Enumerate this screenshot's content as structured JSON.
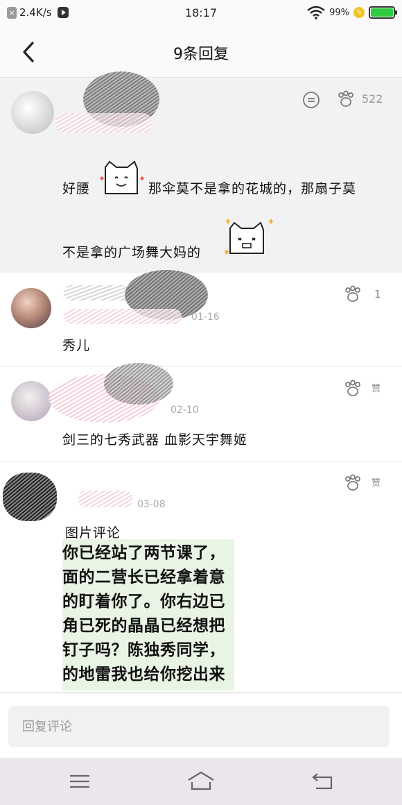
{
  "status_bar": {
    "close_glyph": "×",
    "speed": "2.4K/s",
    "time": "18:17",
    "battery_percent": "99%",
    "battery_level": 0.99,
    "bolt_glyph": "ϟ",
    "icons": [
      "notification-close-icon",
      "video-player-icon",
      "wifi-icon",
      "charging-icon",
      "battery-icon"
    ]
  },
  "header": {
    "title": "9条回复",
    "back_icon": "chevron-left-icon"
  },
  "main_post": {
    "like_count": "522",
    "line1_a": "好腰",
    "line1_b": "那伞莫不是拿的花城的，那扇子莫",
    "line2": "不是拿的广场舞大妈的",
    "icons": [
      "comment-bubble-icon",
      "paw-like-icon"
    ]
  },
  "comments": [
    {
      "date": "01-16",
      "text": "秀儿",
      "like_label": "1"
    },
    {
      "date": "02-10",
      "text": "剑三的七秀武器 血影天宇舞姬",
      "like_label": "赞"
    },
    {
      "date": "03-08",
      "text": "图片评论",
      "like_label": "赞",
      "image_lines": [
        "你已经站了两节课了，",
        "面的二营长已经拿着意",
        "的盯着你了。你右边已",
        "角已死的晶晶已经想把",
        "钉子吗？陈独秀同学，",
        "的地雷我也给你挖出来"
      ]
    }
  ],
  "reply": {
    "placeholder": "回复评论"
  },
  "nav": {
    "icons": [
      "menu-icon",
      "home-icon",
      "back-icon"
    ]
  },
  "colors": {
    "background": "#fbf9fb",
    "post_bg": "#f2f1f3",
    "battery_green": "#2ecc40",
    "image_bg": "#e8f4e4"
  }
}
